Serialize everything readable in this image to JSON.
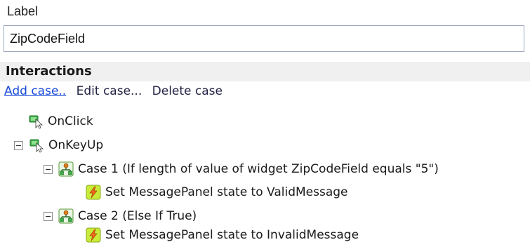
{
  "label": {
    "caption": "Label",
    "value": "ZipCodeField"
  },
  "interactions": {
    "title": "Interactions",
    "actions": {
      "add": "Add case..",
      "edit": "Edit case...",
      "delete": "Delete case"
    },
    "tree": {
      "onclick": "OnClick",
      "onkeyup": "OnKeyUp",
      "case1": "Case 1 (If length of value of widget ZipCodeField equals \"5\")",
      "case1_action": "Set MessagePanel state to ValidMessage",
      "case2": "Case 2 (Else If True)",
      "case2_action": "Set MessagePanel state to InvalidMessage"
    }
  },
  "colors": {
    "link": "#1a4bd8",
    "header_bg": "#f0f0f0",
    "input_border": "#9aa8bd"
  },
  "icons": {
    "event": "event-cursor-icon",
    "case": "case-tree-icon",
    "action": "lightning-action-icon"
  }
}
